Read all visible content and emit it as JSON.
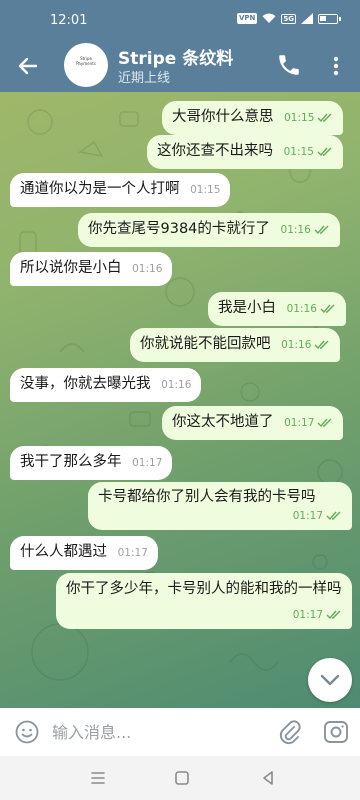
{
  "status_bar": {
    "time": "12:01",
    "vpn_label": "VPN",
    "network_label": "5G",
    "icons": [
      "vpn-icon",
      "wifi-icon",
      "sim-icon",
      "battery-icon"
    ]
  },
  "header": {
    "title": "Stripe 条纹料",
    "subtitle": "近期上线",
    "avatar_text": "Stripe Payments",
    "icons": [
      "back-arrow-icon",
      "phone-icon",
      "more-vertical-icon"
    ]
  },
  "messages": [
    {
      "direction": "out",
      "text": "大哥你什么意思",
      "time": "01:15"
    },
    {
      "direction": "out",
      "text": "这你还查不出来吗",
      "time": "01:15"
    },
    {
      "direction": "in",
      "text": "通道你以为是一个人打啊",
      "time": "01:15"
    },
    {
      "direction": "out",
      "text": "你先查尾号9384的卡就行了",
      "time": "01:16"
    },
    {
      "direction": "in",
      "text": "所以说你是小白",
      "time": "01:16"
    },
    {
      "direction": "out",
      "text": "我是小白",
      "time": "01:16"
    },
    {
      "direction": "out",
      "text": "你就说能不能回款吧",
      "time": "01:16"
    },
    {
      "direction": "in",
      "text": "没事，你就去曝光我",
      "time": "01:16"
    },
    {
      "direction": "out",
      "text": "你这太不地道了",
      "time": "01:17"
    },
    {
      "direction": "in",
      "text": "我干了那么多年",
      "time": "01:17"
    },
    {
      "direction": "out",
      "text": "卡号都给你了别人会有我的卡号吗",
      "time": "01:17"
    },
    {
      "direction": "in",
      "text": "什么人都遇过",
      "time": "01:17"
    },
    {
      "direction": "out",
      "text": "你干了多少年，卡号别人的能和我的一样吗",
      "time": "01:17"
    }
  ],
  "input": {
    "placeholder": "输入消息...",
    "value": ""
  },
  "colors": {
    "header_bg": "#5a7f9b",
    "bubble_out": "#effdde",
    "bubble_in": "#ffffff",
    "time_out": "#5fae5a"
  },
  "nav": {
    "icons": [
      "menu-icon",
      "home-icon",
      "back-triangle-icon"
    ]
  }
}
